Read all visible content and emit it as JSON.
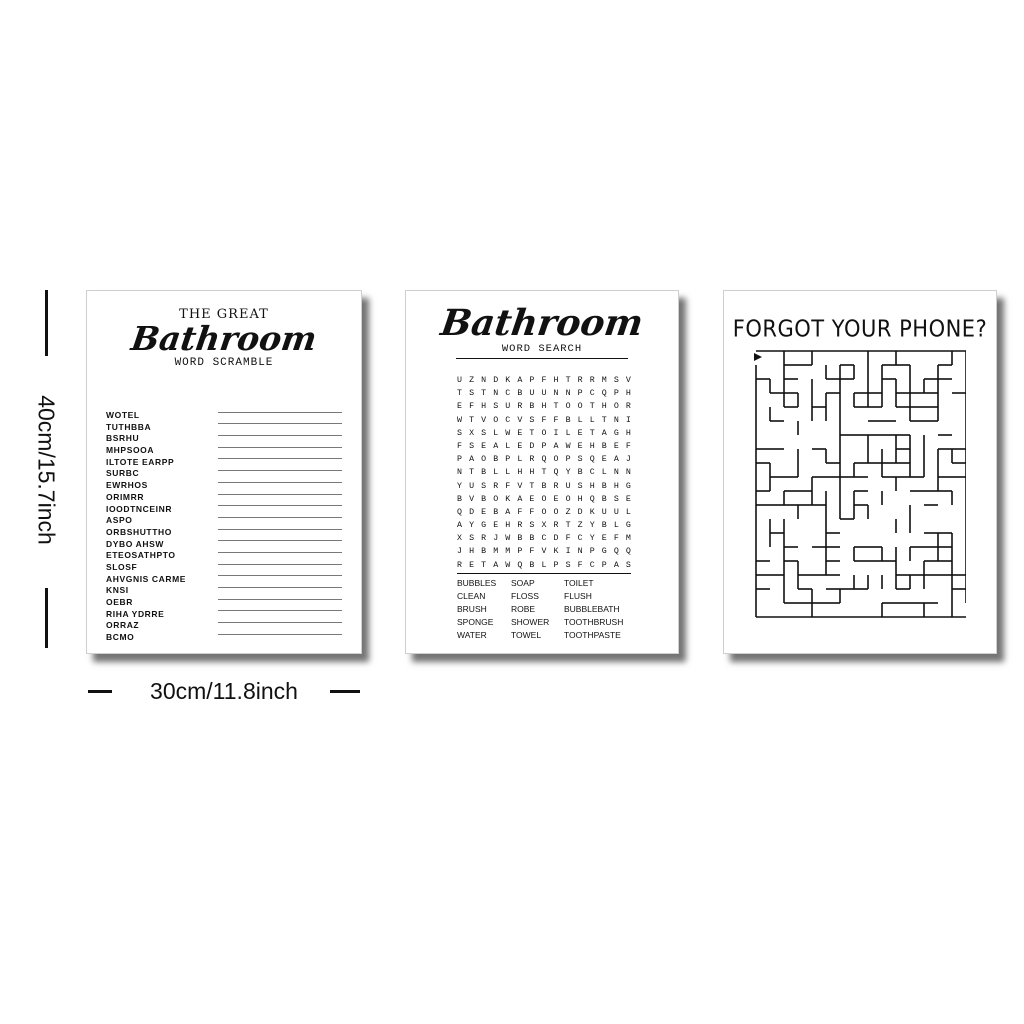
{
  "dimensions": {
    "height_label": "40cm/15.7inch",
    "width_label": "30cm/11.8inch"
  },
  "scramble": {
    "title_top": "THE GREAT",
    "title_script": "Bathroom",
    "subtitle": "WORD SCRAMBLE",
    "words": [
      "WOTEL",
      "TUTHBBA",
      "BSRHU",
      "MHPSOOA",
      "ILTOTE EARPP",
      "SURBC",
      "EWRHOS",
      "ORIMRR",
      "IOODTNCEINR",
      "ASPO",
      "ORBSHUTTHO",
      "DYBO AHSW",
      "ETEOSATHPTO",
      "SLOSF",
      "AHVGNIS CARME",
      "KNSI",
      "OEBR",
      "RIHA YDRRE",
      "ORRAZ",
      "BCMO"
    ]
  },
  "search": {
    "title_script": "Bathroom",
    "subtitle": "WORD SEARCH",
    "grid": [
      "UZNDKAPFHTRRMSV",
      "TSTNCBUUNNPCQPH",
      "EFHSURBHTOOTHOR",
      "WTVOCVSFFBLLTNI",
      "SXSLWETOILETAGH",
      "FSEALEDPAWEHBEF",
      "PAOBPLRQOPSQEAJ",
      "NTBLLHHTQYBCLNN",
      "YUSRFVTBRUSHBHG",
      "BVBOKAEOEOHQBSE",
      "QDEBAFFOOZDKUUL",
      "AYGEHRSXRTZYBLG",
      "XSRJWBBCDFCYEFM",
      "JHBMMPFVKINPGQQ",
      "RETAWQBLPSFCPAS"
    ],
    "words": [
      [
        "BUBBLES",
        "SOAP",
        "TOILET"
      ],
      [
        "CLEAN",
        "FLOSS",
        "FLUSH"
      ],
      [
        "BRUSH",
        "ROBE",
        "BUBBLEBATH"
      ],
      [
        "SPONGE",
        "SHOWER",
        "TOOTHBRUSH"
      ],
      [
        "WATER",
        "TOWEL",
        "TOOTHPASTE"
      ]
    ]
  },
  "maze": {
    "title": "FORGOT YOUR PHONE?"
  }
}
